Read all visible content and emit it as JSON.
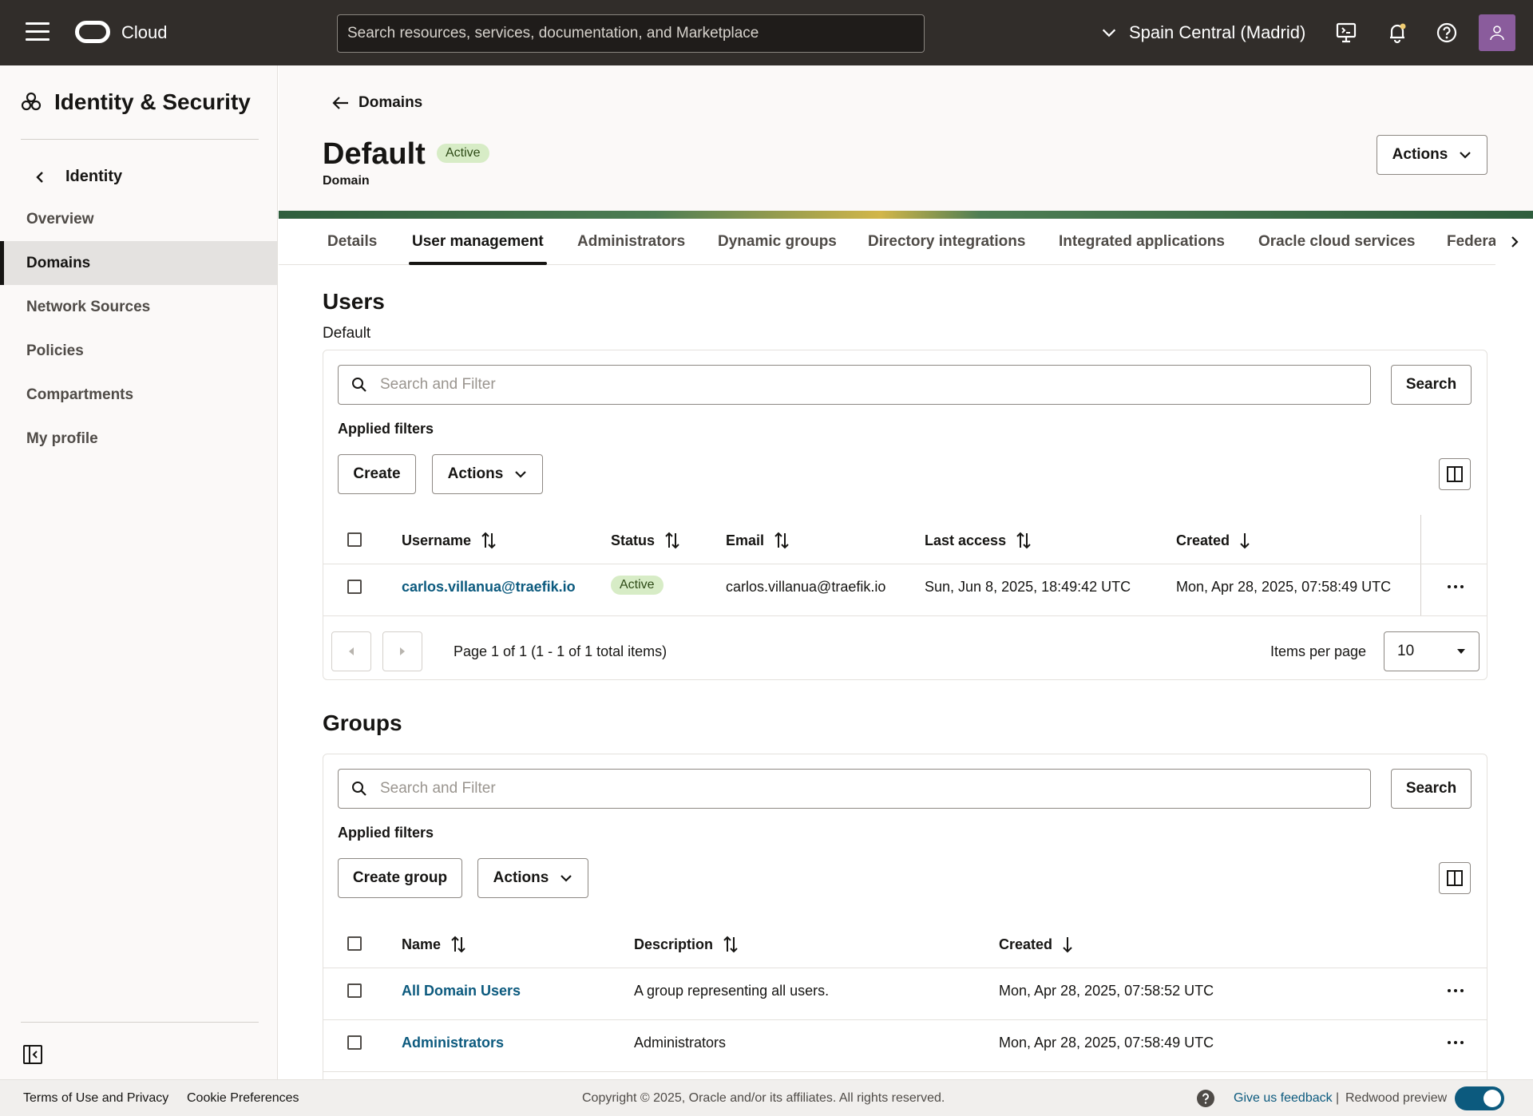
{
  "topbar": {
    "brand": "Cloud",
    "search_placeholder": "Search resources, services, documentation, and Marketplace",
    "region": "Spain Central (Madrid)"
  },
  "sidebar": {
    "title": "Identity & Security",
    "back_label": "Identity",
    "items": [
      {
        "label": "Overview",
        "active": false
      },
      {
        "label": "Domains",
        "active": true
      },
      {
        "label": "Network Sources",
        "active": false
      },
      {
        "label": "Policies",
        "active": false
      },
      {
        "label": "Compartments",
        "active": false
      },
      {
        "label": "My profile",
        "active": false
      }
    ]
  },
  "header": {
    "back_label": "Domains",
    "title": "Default",
    "status": "Active",
    "subtitle": "Domain",
    "actions_label": "Actions"
  },
  "tabs": [
    {
      "label": "Details",
      "active": false
    },
    {
      "label": "User management",
      "active": true
    },
    {
      "label": "Administrators",
      "active": false
    },
    {
      "label": "Dynamic groups",
      "active": false
    },
    {
      "label": "Directory integrations",
      "active": false
    },
    {
      "label": "Integrated applications",
      "active": false
    },
    {
      "label": "Oracle cloud services",
      "active": false
    },
    {
      "label": "Federat",
      "active": false
    }
  ],
  "users": {
    "title": "Users",
    "subtitle": "Default",
    "search_placeholder": "Search and Filter",
    "search_button": "Search",
    "applied_filters": "Applied filters",
    "create_button": "Create",
    "actions_button": "Actions",
    "columns": [
      "Username",
      "Status",
      "Email",
      "Last access",
      "Created"
    ],
    "rows": [
      {
        "username": "carlos.villanua@traefik.io",
        "status": "Active",
        "email": "carlos.villanua@traefik.io",
        "last_access": "Sun, Jun 8, 2025, 18:49:42 UTC",
        "created": "Mon, Apr 28, 2025, 07:58:49 UTC"
      }
    ],
    "pagination": "Page 1 of 1 (1 - 1 of 1 total items)",
    "items_per_page_label": "Items per page",
    "items_per_page": "10"
  },
  "groups": {
    "title": "Groups",
    "search_placeholder": "Search and Filter",
    "search_button": "Search",
    "applied_filters": "Applied filters",
    "create_button": "Create group",
    "actions_button": "Actions",
    "columns": [
      "Name",
      "Description",
      "Created"
    ],
    "rows": [
      {
        "name": "All Domain Users",
        "description": "A group representing all users.",
        "created": "Mon, Apr 28, 2025, 07:58:52 UTC"
      },
      {
        "name": "Administrators",
        "description": "Administrators",
        "created": "Mon, Apr 28, 2025, 07:58:49 UTC"
      }
    ]
  },
  "footer": {
    "terms": "Terms of Use and Privacy",
    "cookies": "Cookie Preferences",
    "copyright": "Copyright © 2025, Oracle and/or its affiliates. All rights reserved.",
    "feedback": "Give us feedback",
    "separator": "|",
    "preview": "Redwood preview"
  }
}
